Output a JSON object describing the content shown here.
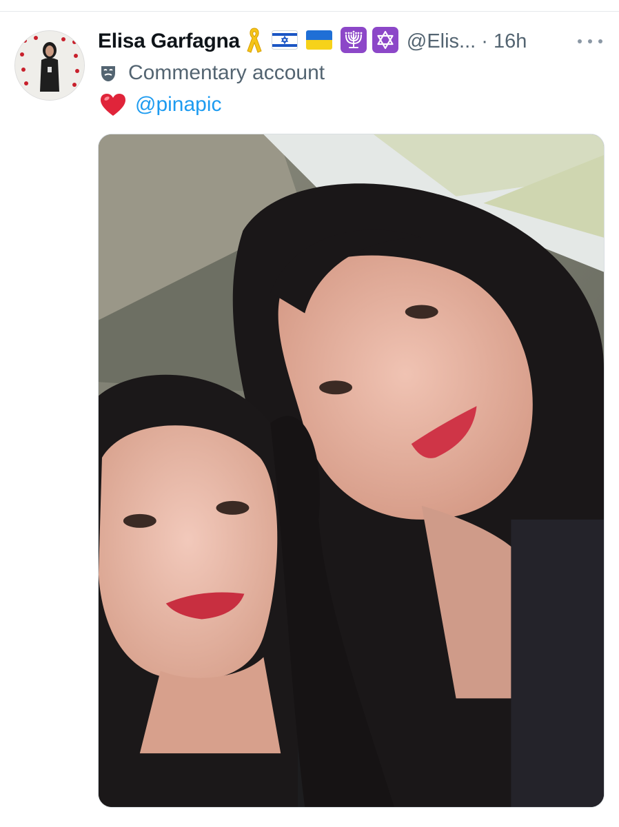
{
  "tweet": {
    "author": {
      "display_name": "Elisa Garfagna",
      "handle_time": "@Elis... · 16h",
      "avatar_icon": "profile-photo",
      "badges": [
        "yellow-ribbon-icon",
        "israel-flag-icon",
        "ukraine-flag-icon",
        "menorah-icon",
        "star-of-david-icon"
      ]
    },
    "more_icon": "more-options-icon",
    "bio": {
      "icon": "theater-mask-icon",
      "label": "Commentary account"
    },
    "text": {
      "icon": "red-heart-icon",
      "mention": "@pinapic"
    },
    "media": {
      "type": "photo",
      "subject": "selfie of two women"
    }
  },
  "colors": {
    "name": "#0f1419",
    "secondary": "#536471",
    "link": "#1d9bf0",
    "heart": "#e0243a",
    "badge_purple": "#8c47c8"
  }
}
